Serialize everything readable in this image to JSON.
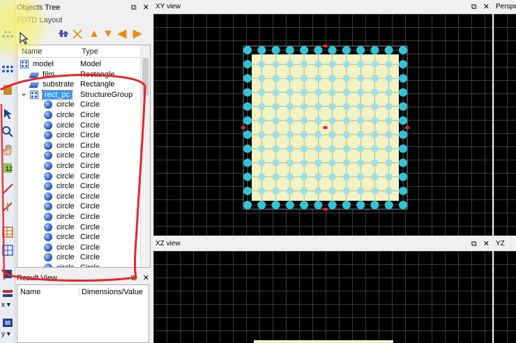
{
  "objects_tree": {
    "title": "Objects Tree",
    "subtitle": "FDTD Layout",
    "columns": [
      "Name",
      "Type"
    ],
    "rows": [
      {
        "name": "model",
        "type": "Model",
        "level": 0,
        "icon": "group-icon"
      },
      {
        "name": "film",
        "type": "Rectangle",
        "level": 1,
        "icon": "slab-icon"
      },
      {
        "name": "substrate",
        "type": "Rectangle",
        "level": 1,
        "icon": "slab-icon"
      },
      {
        "name": "rect_pc",
        "type": "StructureGroup",
        "level": 1,
        "icon": "group-icon",
        "selected": true,
        "expanded": true
      },
      {
        "name": "circle",
        "type": "Circle",
        "level": 2,
        "icon": "sphere-icon"
      },
      {
        "name": "circle",
        "type": "Circle",
        "level": 2,
        "icon": "sphere-icon"
      },
      {
        "name": "circle",
        "type": "Circle",
        "level": 2,
        "icon": "sphere-icon"
      },
      {
        "name": "circle",
        "type": "Circle",
        "level": 2,
        "icon": "sphere-icon"
      },
      {
        "name": "circle",
        "type": "Circle",
        "level": 2,
        "icon": "sphere-icon"
      },
      {
        "name": "circle",
        "type": "Circle",
        "level": 2,
        "icon": "sphere-icon"
      },
      {
        "name": "circle",
        "type": "Circle",
        "level": 2,
        "icon": "sphere-icon"
      },
      {
        "name": "circle",
        "type": "Circle",
        "level": 2,
        "icon": "sphere-icon"
      },
      {
        "name": "circle",
        "type": "Circle",
        "level": 2,
        "icon": "sphere-icon"
      },
      {
        "name": "circle",
        "type": "Circle",
        "level": 2,
        "icon": "sphere-icon"
      },
      {
        "name": "circle",
        "type": "Circle",
        "level": 2,
        "icon": "sphere-icon"
      },
      {
        "name": "circle",
        "type": "Circle",
        "level": 2,
        "icon": "sphere-icon"
      },
      {
        "name": "circle",
        "type": "Circle",
        "level": 2,
        "icon": "sphere-icon"
      },
      {
        "name": "circle",
        "type": "Circle",
        "level": 2,
        "icon": "sphere-icon"
      },
      {
        "name": "circle",
        "type": "Circle",
        "level": 2,
        "icon": "sphere-icon"
      },
      {
        "name": "circle",
        "type": "Circle",
        "level": 2,
        "icon": "sphere-icon"
      },
      {
        "name": "circle",
        "type": "Circle",
        "level": 2,
        "icon": "sphere-icon"
      }
    ]
  },
  "result_view": {
    "title": "Result View",
    "columns": [
      "Name",
      "Dimensions/Value"
    ]
  },
  "views": {
    "xy": "XY view",
    "perspective": "Perspe",
    "xz": "XZ view",
    "yz": "YZ view"
  },
  "panel_buttons": {
    "float": "⧉",
    "close": "✕"
  },
  "toolbar_labels": {
    "x_axis": "x",
    "y_axis": "y"
  },
  "pc_lattice": {
    "columns": 12,
    "rows": 12
  },
  "colors": {
    "selection": "#3399ff",
    "circle": "#31c4d9",
    "substrate": "#f1f3c4",
    "annotation": "#e8242a",
    "highlight": "#f7f06a"
  }
}
